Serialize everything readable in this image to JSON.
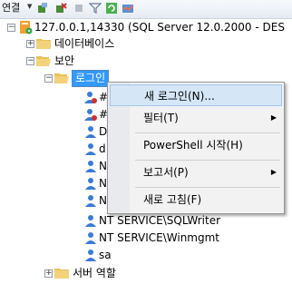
{
  "toolbar": {
    "connect_label": "연결"
  },
  "tree": {
    "server": "127.0.0.1,14330 (SQL Server 12.0.2000 - DES",
    "databases": "데이터베이스",
    "security": "보안",
    "logins": "로그인",
    "hidden_items": [
      "#",
      "#",
      "D",
      "d",
      "N",
      "N",
      "N"
    ],
    "sqlwriter": "NT SERVICE\\SQLWriter",
    "winmgmt": "NT SERVICE\\Winmgmt",
    "sa": "sa",
    "server_roles": "서버 역할"
  },
  "context_menu": {
    "items": [
      {
        "label": "새 로그인(N)...",
        "submenu": false
      },
      {
        "label": "필터(T)",
        "submenu": true
      },
      {
        "label": "PowerShell 시작(H)",
        "submenu": false
      },
      {
        "label": "보고서(P)",
        "submenu": true
      },
      {
        "label": "새로 고침(F)",
        "submenu": false
      }
    ]
  },
  "colors": {
    "selection": "#3399ff",
    "menu_highlight": "#d5e6f7",
    "folder": "#e8c15a"
  }
}
